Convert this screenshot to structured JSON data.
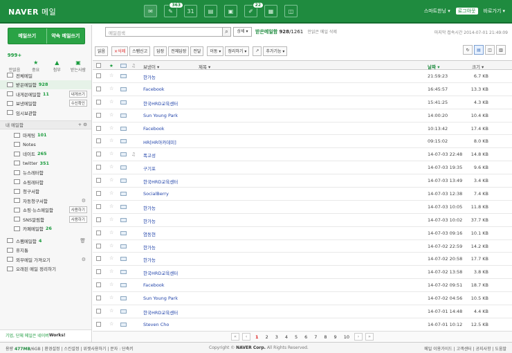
{
  "header": {
    "logo": "NAVER",
    "service": "메일",
    "apps": [
      {
        "name": "mail-app-icon",
        "glyph": "✉",
        "badge": ""
      },
      {
        "name": "draw-app-icon",
        "glyph": "✎",
        "badge": "363"
      },
      {
        "name": "calendar-app-icon",
        "glyph": "31",
        "badge": ""
      },
      {
        "name": "memo-app-icon",
        "glyph": "▤",
        "badge": ""
      },
      {
        "name": "contacts-app-icon",
        "glyph": "▣",
        "badge": ""
      },
      {
        "name": "note-app-icon",
        "glyph": "✐",
        "badge": "22"
      },
      {
        "name": "photo-app-icon",
        "glyph": "▦",
        "badge": ""
      },
      {
        "name": "cloud-app-icon",
        "glyph": "◫",
        "badge": ""
      }
    ],
    "user": "스마트한닝 ▾",
    "logout": "로그아웃",
    "shortcuts": "바로가기 ▾"
  },
  "sidebar": {
    "compose": "메일쓰기",
    "reserve": "약속 메일쓰기",
    "quick": [
      {
        "num": "999+",
        "icon": "",
        "label": "안읽음"
      },
      {
        "num": "",
        "icon": "★",
        "label": "중요"
      },
      {
        "num": "",
        "icon": "▲",
        "label": "첨부"
      },
      {
        "num": "",
        "icon": "▣",
        "label": "받는사람"
      }
    ],
    "folders": [
      {
        "label": "전체메일",
        "count": "",
        "action": "",
        "selected": false
      },
      {
        "label": "받은메일함",
        "count": "928",
        "action": "",
        "selected": true
      },
      {
        "label": "내게쓴메일함",
        "count": "11",
        "action": "내게쓰기",
        "selected": false
      },
      {
        "label": "보낸메일함",
        "count": "",
        "action": "수신확인",
        "selected": false
      },
      {
        "label": "임시보관함",
        "count": "",
        "action": "",
        "selected": false
      }
    ],
    "my_section": "내 메일함",
    "my_folders": [
      {
        "label": "마케팅",
        "count": "101",
        "action": ""
      },
      {
        "label": "Notes",
        "count": "",
        "action": ""
      },
      {
        "label": "네이트",
        "count": "265",
        "action": ""
      },
      {
        "label": "twitter",
        "count": "351",
        "action": ""
      },
      {
        "label": "뉴스레터함",
        "count": "",
        "action": ""
      },
      {
        "label": "쇼핑레터함",
        "count": "",
        "action": ""
      },
      {
        "label": "청구서함",
        "count": "",
        "action": ""
      },
      {
        "label": "자동청구서함",
        "count": "",
        "action": "⚙"
      },
      {
        "label": "쇼핑·뉴스메일함",
        "count": "",
        "action": "사용하기"
      },
      {
        "label": "SNS알림함",
        "count": "",
        "action": "사용하기"
      },
      {
        "label": "카페메일함",
        "count": "26",
        "action": ""
      }
    ],
    "bottom_folders": [
      {
        "label": "스팸메일함",
        "count": "4",
        "action": "🗑"
      },
      {
        "label": "휴지통",
        "count": "",
        "action": ""
      },
      {
        "label": "외부메일 가져오기",
        "count": "",
        "action": "⚙"
      },
      {
        "label": "오래된 메일 정리하기",
        "count": "",
        "action": ""
      }
    ],
    "promo_a": "기업, 단체 메일은 네이버 ",
    "promo_b": "Works!"
  },
  "main": {
    "search_placeholder": "메일검색",
    "detail": "상세 ▾",
    "mailbox": "받은메일함",
    "count_unread": "928",
    "count_total": "1261",
    "delete_read": "안읽은 메일 삭제",
    "last_login": "마지막 접속시간 2014-07-01 21:49:09",
    "toolbar": [
      "읽음",
      "×삭제",
      "스팸신고",
      "답장",
      "전체답장",
      "전달",
      "이동 ▾",
      "정리하기 ▾",
      "↗",
      "추가기능 ▾"
    ],
    "columns": {
      "sender": "보낸이 ▾",
      "subject": "제목 ▾",
      "date": "날짜 ▾",
      "size": "크기 ▾"
    },
    "rows": [
      {
        "sender": "한가능",
        "subject": "메일을 트래킹 합니다.",
        "date": "21:59:23",
        "size": "6.7 KB",
        "attach": ""
      },
      {
        "sender": "Facebook",
        "subject": "Jonghyeok Kim님이 회원님과 Facebook 친구 요청을 보냈습니다.",
        "date": "16:45:57",
        "size": "13.3 KB",
        "attach": ""
      },
      {
        "sender": "한국HRD교육센터",
        "subject": "[환급교육] 통상임금 분쟁대비 예방대책 (7.18 본관)",
        "date": "15:41:25",
        "size": "4.3 KB",
        "attach": ""
      },
      {
        "sender": "Sun Young Park",
        "subject": "[Smart People Smart Life] <iframe width=\"560\" height=\"315\"...",
        "date": "14:00:20",
        "size": "10.4 KB",
        "attach": ""
      },
      {
        "sender": "Facebook",
        "subject": "장영민님이 타임라인 사진 사진첩에 새로운 사진을 추가했습니다.",
        "date": "10:13:42",
        "size": "17.4 KB",
        "attach": ""
      },
      {
        "sender": "HR[HR아카데미]",
        "subject": "[HRDIST의 HRD심포교육 시리즈 : HRD 실무에 필요한 문서 마스터(7/29)]",
        "date": "09:15:02",
        "size": "8.0 KB",
        "attach": ""
      },
      {
        "sender": "폭고성",
        "subject": "안녕하세요. 가수\"폭고성\"입니다.",
        "date": "14-07-03 22:48",
        "size": "14.8 KB",
        "attach": "♫"
      },
      {
        "sender": "구기포",
        "subject": "[Smart People Smart Life] 감격들으러 왔어요.ㅋ",
        "date": "14-07-03 19:35",
        "size": "9.6 KB",
        "attach": ""
      },
      {
        "sender": "한국HRD교육센터",
        "subject": "[환급교육] 제고관리 및 제고삭감 실천 (7.17-7.18 별관)",
        "date": "14-07-03 13:49",
        "size": "3.4 KB",
        "attach": ""
      },
      {
        "sender": "SocialBerry",
        "subject": ":: New 제비용 고효율의 보도자료 상품, Public Service 안내 드립니다. ::",
        "date": "14-07-03 12:38",
        "size": "7.4 KB",
        "attach": ""
      },
      {
        "sender": "한가능",
        "subject": "[Smart People Smart Life] 웃는 하는데...",
        "date": "14-07-03 10:05",
        "size": "11.8 KB",
        "attach": ""
      },
      {
        "sender": "한가능",
        "subject": "[Smart People Smart Life] 좋은 책을 읽어야 할 이유 50가지",
        "date": "14-07-03 10:02",
        "size": "37.7 KB",
        "attach": ""
      },
      {
        "sender": "염동현",
        "subject": "[Smart People Smart Life] 도로일 오후5시에 진행되는 미니 운동회 장소 안내드립니다.",
        "date": "14-07-03 09:16",
        "size": "10.1 KB",
        "attach": ""
      },
      {
        "sender": "한가능",
        "subject": "[Smart People Smart Life] 주민식 이사님께서 해주신 지에임주소록 통합을 포스팅해봤습니다.",
        "date": "14-07-02 22:59",
        "size": "14.2 KB",
        "attach": ""
      },
      {
        "sender": "한가능",
        "subject": "[Smart People Smart Life] 이번주 과제는 블로그 만들기 입니다.",
        "date": "14-07-02 20:58",
        "size": "17.7 KB",
        "attach": ""
      },
      {
        "sender": "한국HRD교육센터",
        "subject": "[스마트사원 Level Up] 기업 소설트렌 전략 (7.16 별관)",
        "date": "14-07-02 13:58",
        "size": "3.8 KB",
        "attach": ""
      },
      {
        "sender": "Facebook",
        "subject": "장영민님이 타임라인 사진 사진첩에 새로운 사진을 추가했습니다.",
        "date": "14-07-02 09:51",
        "size": "18.7 KB",
        "attach": ""
      },
      {
        "sender": "Sun Young Park",
        "subject": "[Smart People Smart Life] 이제 퇴근하려고 짐을 싸다가... 글 남깁니다.",
        "date": "14-07-02 04:56",
        "size": "10.5 KB",
        "attach": ""
      },
      {
        "sender": "한국HRD교육센터",
        "subject": "[환급교육] 중소기업을 위한 해외 마케팅 전략 (7.15 별관)",
        "date": "14-07-01 14:48",
        "size": "4.4 KB",
        "attach": ""
      },
      {
        "sender": "Steven Cho",
        "subject": "[Smart People Smart Life] 지금 제가 사무실에서 보고 있는 화면입니다...",
        "date": "14-07-01 10:12",
        "size": "12.5 KB",
        "attach": ""
      }
    ],
    "pages": [
      "1",
      "2",
      "3",
      "4",
      "5",
      "6",
      "7",
      "8",
      "9",
      "10"
    ],
    "current_page": "1"
  },
  "footer": {
    "usage": "용량 ",
    "usage_val": "477MB",
    "usage_total": "/6GB",
    "links": " | 환경설정 | 스킨설정 | 위젯사용하기 | 문자 : 단축키",
    "copyright": "Copyright © ",
    "company": "NAVER Corp.",
    "rights": " All Rights Reserved.",
    "right": "메일 이용가이드 | 고객센터 | 공지사항 | 도움말"
  }
}
